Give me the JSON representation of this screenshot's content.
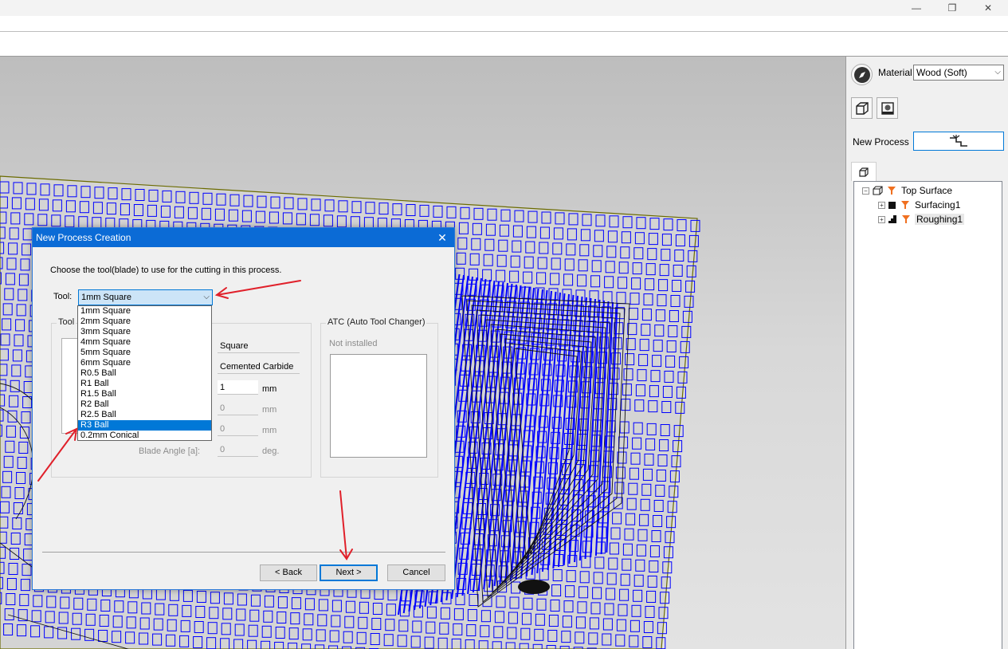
{
  "window": {
    "minimize": "—",
    "maximize": "❐",
    "close": "✕"
  },
  "panel": {
    "material_label": "Material",
    "material_value": "Wood (Soft)",
    "new_process_label": "New Process",
    "tree": [
      {
        "label": "Top Surface",
        "expander": "−"
      },
      {
        "label": "Surfacing1",
        "expander": "+"
      },
      {
        "label": "Roughing1",
        "expander": "+"
      }
    ]
  },
  "dialog": {
    "title": "New Process Creation",
    "close": "✕",
    "instruction": "Choose the tool(blade) to use for the cutting in this process.",
    "tool_label": "Tool:",
    "tool_selected": "1mm Square",
    "tool_group_label": "Tool",
    "tool_options": [
      "1mm Square",
      "2mm Square",
      "3mm Square",
      "4mm Square",
      "5mm Square",
      "6mm Square",
      "R0.5 Ball",
      "R1 Ball",
      "R1.5 Ball",
      "R2 Ball",
      "R2.5 Ball",
      "R3 Ball",
      "0.2mm Conical"
    ],
    "highlighted_option": "R3 Ball",
    "fields": {
      "shape": "Square",
      "material": "Cemented Carbide",
      "diameter": "1",
      "diameter_unit": "mm",
      "f2": "0",
      "f2_unit": "mm",
      "f3": "0",
      "f3_unit": "mm",
      "blade_angle_label": "Blade Angle [a]:",
      "blade_angle": "0",
      "blade_angle_unit": "deg."
    },
    "atc_label": "ATC (Auto Tool Changer)",
    "atc_status": "Not installed",
    "buttons": {
      "back": "< Back",
      "next": "Next >",
      "cancel": "Cancel"
    }
  },
  "colors": {
    "accent": "#0b6bd6",
    "toolpath": "#0000ff",
    "annotation": "#e0202a"
  }
}
